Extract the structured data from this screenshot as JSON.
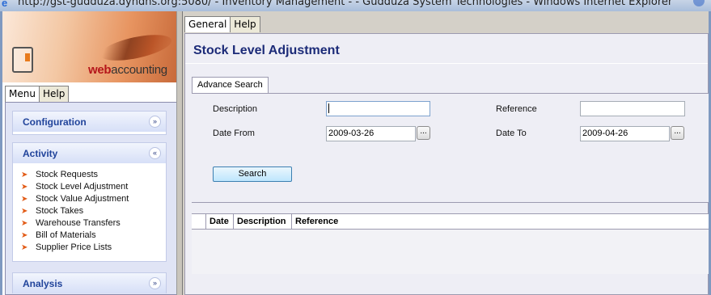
{
  "window": {
    "title": "http://gst-gudduza.dyndns.org:5080/ - Inventory Management - - Gudduza System Technologies - Windows Internet Explorer"
  },
  "logo": {
    "brand_bold": "web",
    "brand_rest": "accounting"
  },
  "left_tabs": [
    {
      "label": "Menu"
    },
    {
      "label": "Help"
    }
  ],
  "sidebar": {
    "sections": [
      {
        "label": "Configuration",
        "expanded": false,
        "icon": "chevron-double-down-icon"
      },
      {
        "label": "Activity",
        "expanded": true,
        "icon": "chevron-double-up-icon",
        "items": [
          {
            "label": "Stock Requests"
          },
          {
            "label": "Stock Level Adjustment"
          },
          {
            "label": "Stock Value Adjustment"
          },
          {
            "label": "Stock Takes"
          },
          {
            "label": "Warehouse Transfers"
          },
          {
            "label": "Bill of Materials"
          },
          {
            "label": "Supplier Price Lists"
          }
        ]
      },
      {
        "label": "Analysis",
        "expanded": false,
        "icon": "chevron-double-down-icon"
      }
    ]
  },
  "main_tabs": [
    {
      "label": "General"
    },
    {
      "label": "Help"
    }
  ],
  "page": {
    "title": "Stock Level Adjustment",
    "search_tab": "Advance Search"
  },
  "search_form": {
    "description_label": "Description",
    "description_value": "",
    "reference_label": "Reference",
    "reference_value": "",
    "date_from_label": "Date From",
    "date_from_value": "2009-03-26",
    "date_to_label": "Date To",
    "date_to_value": "2009-04-26",
    "picker_label": "...",
    "search_button": "Search"
  },
  "results_table": {
    "columns": [
      "Date",
      "Description",
      "Reference"
    ],
    "rows": []
  },
  "colors": {
    "title_blue": "#1c2b78",
    "section_blue": "#21449b",
    "arrow_orange": "#e25b16",
    "brand_red": "#b5161b"
  }
}
